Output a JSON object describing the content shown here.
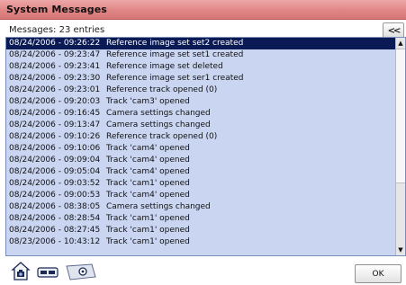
{
  "window": {
    "title": "System Messages"
  },
  "header": {
    "count_label": "Messages: 23 entries",
    "collapse_label": "<<"
  },
  "messages": [
    {
      "ts": "08/24/2006 - 09:26:22",
      "text": "Reference image set set2 created",
      "selected": true
    },
    {
      "ts": "08/24/2006 - 09:23:47",
      "text": "Reference image set set1 created"
    },
    {
      "ts": "08/24/2006 - 09:23:41",
      "text": "Reference image set deleted"
    },
    {
      "ts": "08/24/2006 - 09:23:30",
      "text": "Reference image set ser1 created"
    },
    {
      "ts": "08/24/2006 - 09:23:01",
      "text": "Reference track opened (0)"
    },
    {
      "ts": "08/24/2006 - 09:20:03",
      "text": "Track 'cam3' opened"
    },
    {
      "ts": "08/24/2006 - 09:16:45",
      "text": "Camera settings changed"
    },
    {
      "ts": "08/24/2006 - 09:13:47",
      "text": "Camera settings changed"
    },
    {
      "ts": "08/24/2006 - 09:10:26",
      "text": "Reference track opened (0)"
    },
    {
      "ts": "08/24/2006 - 09:10:06",
      "text": "Track 'cam4' opened"
    },
    {
      "ts": "08/24/2006 - 09:09:04",
      "text": "Track 'cam4' opened"
    },
    {
      "ts": "08/24/2006 - 09:05:04",
      "text": "Track 'cam4' opened"
    },
    {
      "ts": "08/24/2006 - 09:03:52",
      "text": "Track 'cam1' opened"
    },
    {
      "ts": "08/24/2006 - 09:00:53",
      "text": "Track 'cam4' opened"
    },
    {
      "ts": "08/24/2006 - 08:38:05",
      "text": "Camera settings changed"
    },
    {
      "ts": "08/24/2006 - 08:28:54",
      "text": "Track 'cam1' opened"
    },
    {
      "ts": "08/24/2006 - 08:27:45",
      "text": "Track 'cam1' opened"
    },
    {
      "ts": "08/23/2006 - 10:43:12",
      "text": "Track 'cam1' opened"
    }
  ],
  "scrollbar": {
    "up_arrow": "▲",
    "down_arrow": "▼"
  },
  "toolbar": {
    "icons": [
      "home-camera-icon",
      "message-filter-icon",
      "export-icon"
    ]
  },
  "footer": {
    "ok_label": "OK"
  },
  "colors": {
    "titlebar": "#e08686",
    "list_background": "#c9d5f1",
    "selection": "#0a1a55"
  }
}
